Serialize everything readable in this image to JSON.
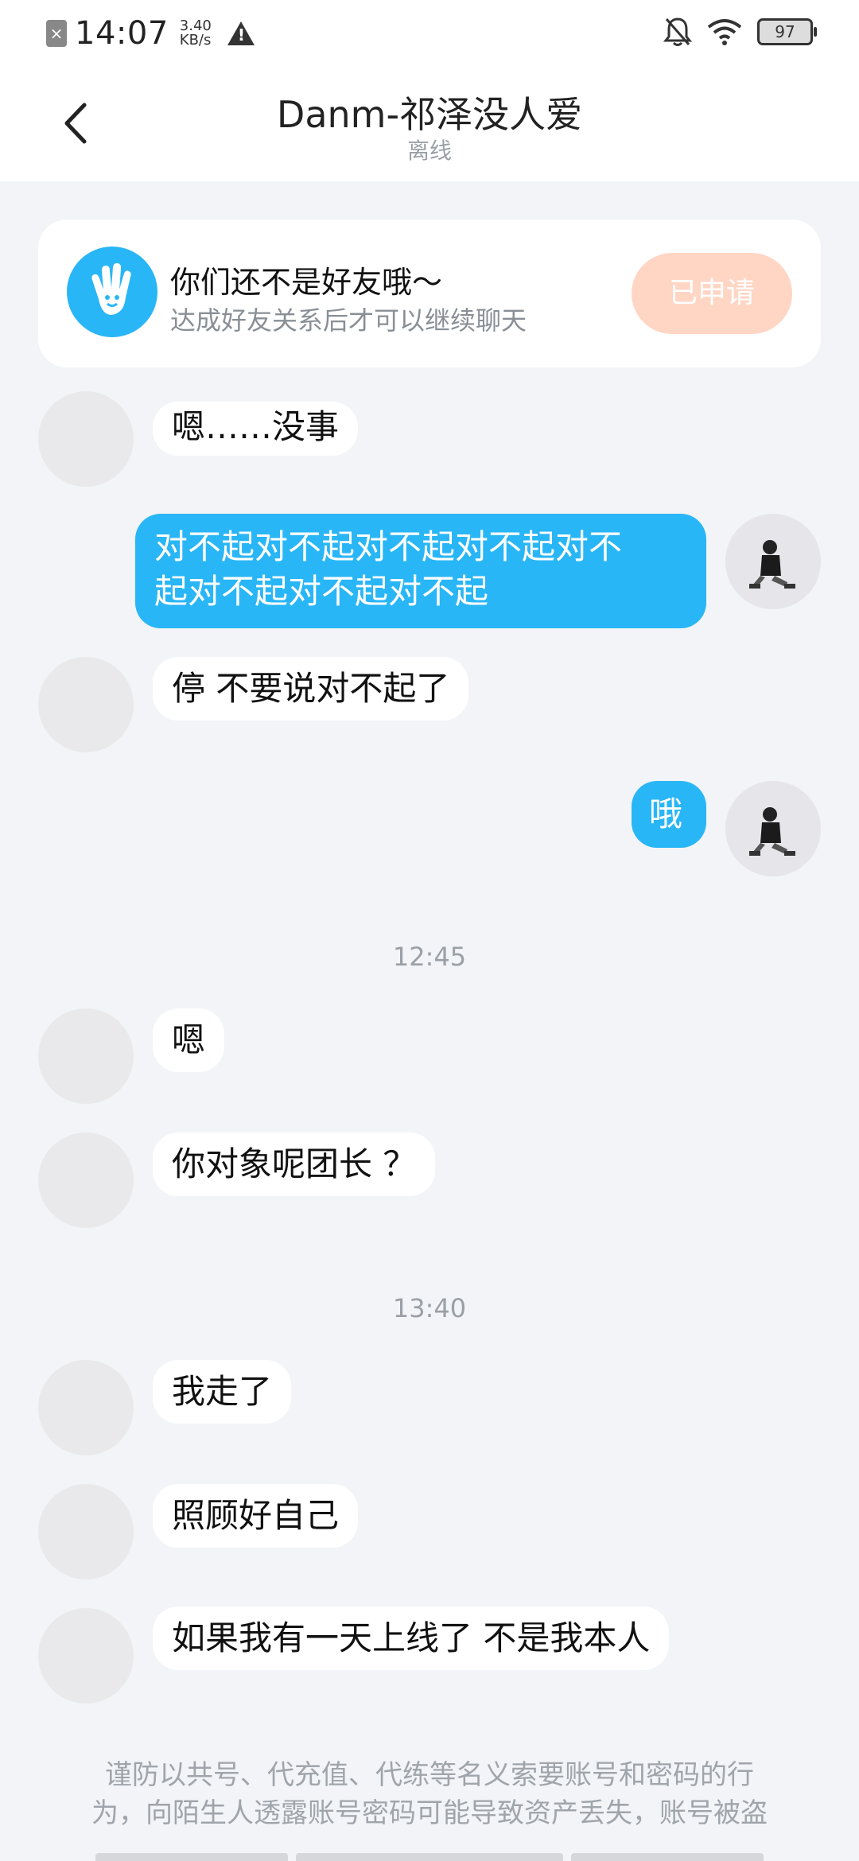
{
  "status_bar": {
    "time": "14:07",
    "net_speed_value": "3.40",
    "net_speed_unit": "KB/s",
    "battery": "97"
  },
  "header": {
    "title": "Danm-祁泽没人爱",
    "status": "离线"
  },
  "friend_notice": {
    "title": "你们还不是好友哦～",
    "subtitle": "达成好友关系后才可以继续聊天",
    "button_label": "已申请"
  },
  "messages": [
    {
      "side": "left",
      "text": "嗯……没事"
    },
    {
      "side": "right",
      "line1": "对不起对不起对不起对不起对不",
      "line2": "起对不起对不起对不起"
    },
    {
      "side": "left",
      "text": "停 不要说对不起了"
    },
    {
      "side": "right",
      "text": "哦"
    },
    {
      "timestamp": "12:45"
    },
    {
      "side": "left",
      "text": "嗯"
    },
    {
      "side": "left",
      "text": "你对象呢团长 ？"
    },
    {
      "timestamp": "13:40"
    },
    {
      "side": "left",
      "text": "我走了"
    },
    {
      "side": "left",
      "text": "照顾好自己"
    },
    {
      "side": "left",
      "text": "如果我有一天上线了 不是我本人"
    }
  ],
  "footer_notice": {
    "line1": "谨防以共号、代充值、代练等名义索要账号和密码的行",
    "line2": "为，向陌生人透露账号密码可能导致资产丢失，账号被盗"
  },
  "colors": {
    "accent": "#29b6f6",
    "applied_button": "#ffd5c4",
    "background": "#f2f4f7"
  }
}
